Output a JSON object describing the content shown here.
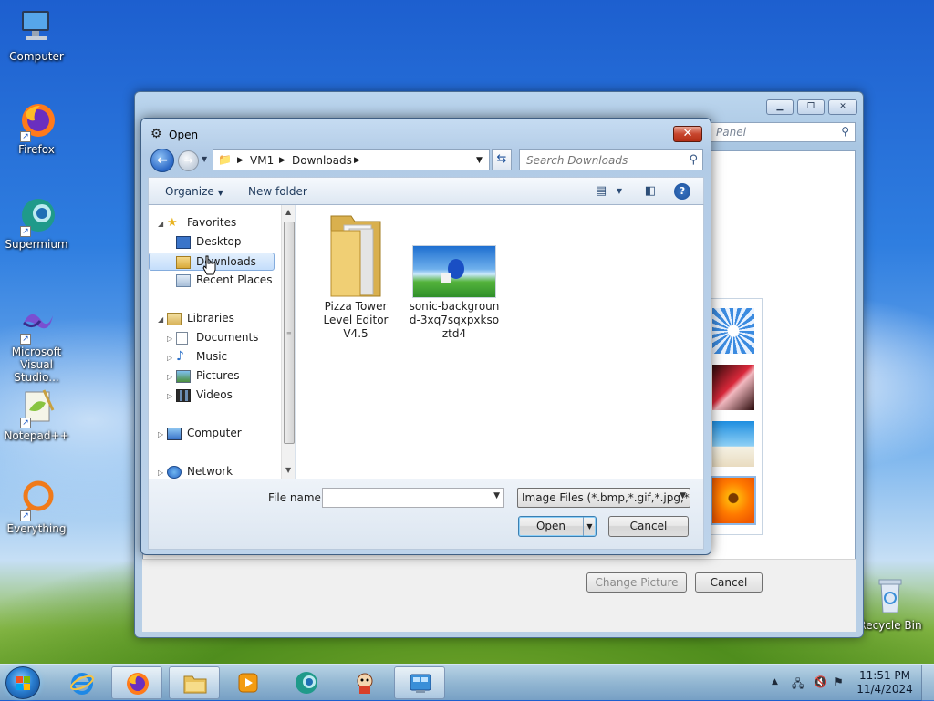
{
  "desktop": {
    "icons": [
      {
        "label": "Computer",
        "icon": "computer-icon"
      },
      {
        "label": "Firefox",
        "icon": "firefox-icon"
      },
      {
        "label": "Supermium",
        "icon": "supermium-icon"
      },
      {
        "label": "Microsoft Visual Studio...",
        "icon": "visual-studio-icon"
      },
      {
        "label": "Notepad++",
        "icon": "notepadpp-icon"
      },
      {
        "label": "Everything",
        "icon": "everything-icon"
      },
      {
        "label": "Recycle Bin",
        "icon": "recycle-bin-icon"
      }
    ]
  },
  "background_window": {
    "search_placeholder": "Panel",
    "change_picture_label": "Change Picture",
    "cancel_label": "Cancel"
  },
  "dialog": {
    "title": "Open",
    "close_glyph": "✕",
    "breadcrumb": [
      "VM1",
      "Downloads"
    ],
    "search_placeholder": "Search Downloads",
    "toolbar": {
      "organize_label": "Organize",
      "new_folder_label": "New folder"
    },
    "nav": {
      "favorites": "Favorites",
      "desktop": "Desktop",
      "downloads": "Downloads",
      "recent_places": "Recent Places",
      "libraries": "Libraries",
      "documents": "Documents",
      "music": "Music",
      "pictures": "Pictures",
      "videos": "Videos",
      "computer": "Computer",
      "network": "Network"
    },
    "files": [
      {
        "name": "Pizza Tower Level Editor V4.5",
        "type": "folder"
      },
      {
        "name": "sonic-background-3xq7sqxpxksoztd4",
        "type": "image"
      }
    ],
    "file_name_label": "File name:",
    "file_name_value": "",
    "file_type_value": "Image Files (*.bmp,*.gif,*.jpg,*.",
    "open_label": "Open",
    "cancel_label": "Cancel"
  },
  "taskbar": {
    "clock_time": "11:51 PM",
    "clock_date": "11/4/2024"
  },
  "colors": {
    "accent": "#3c7fb1",
    "selection": "#c4defb",
    "close_red": "#c7452d"
  }
}
